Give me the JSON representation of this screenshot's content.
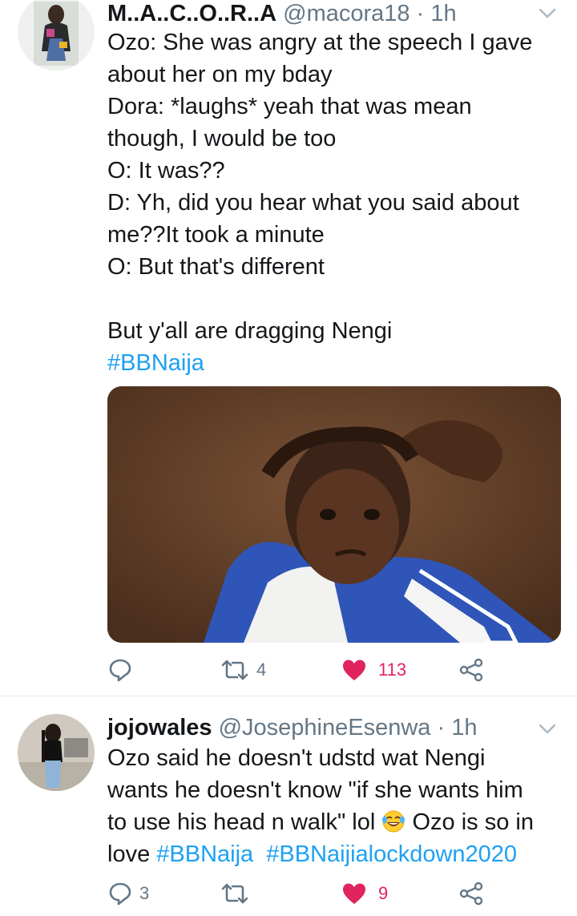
{
  "tweets": [
    {
      "display_name": "M..A..C..O..R..A",
      "handle": "@macora18",
      "separator": "·",
      "time": "1h",
      "lines": [
        "Ozo: She was angry at the speech I gave",
        "about her on my bday",
        "Dora: *laughs* yeah that was mean",
        "though, I would be too",
        "O: It was??",
        "D: Yh, did you hear what you said about",
        "me??It took a minute",
        "O: But that's different",
        "",
        "But y'all are dragging Nengi"
      ],
      "hashtag": "#BBNaija",
      "actions": {
        "reply": "",
        "retweet": "4",
        "like": "113",
        "share": ""
      }
    },
    {
      "display_name": "jojowales",
      "handle": "@JosephineEsenwa",
      "separator": "·",
      "time": "1h",
      "lines": [
        "Ozo said he doesn't udstd wat Nengi",
        "wants he doesn't know \"if she wants him"
      ],
      "line3_text": "to use his head n walk\" lol",
      "line3_after_emoji": "Ozo is so in",
      "line4_text": "love",
      "hashtag1": "#BBNaija",
      "hashtag2": "#BBNaijialockdown2020",
      "emoji": "face-with-tears-of-joy",
      "actions": {
        "reply": "3",
        "retweet": "",
        "like": "9",
        "share": ""
      }
    }
  ],
  "colors": {
    "text": "#14171a",
    "muted": "#657786",
    "link": "#1da1f2",
    "like": "#e0245e",
    "divider": "#e6ecf0"
  }
}
